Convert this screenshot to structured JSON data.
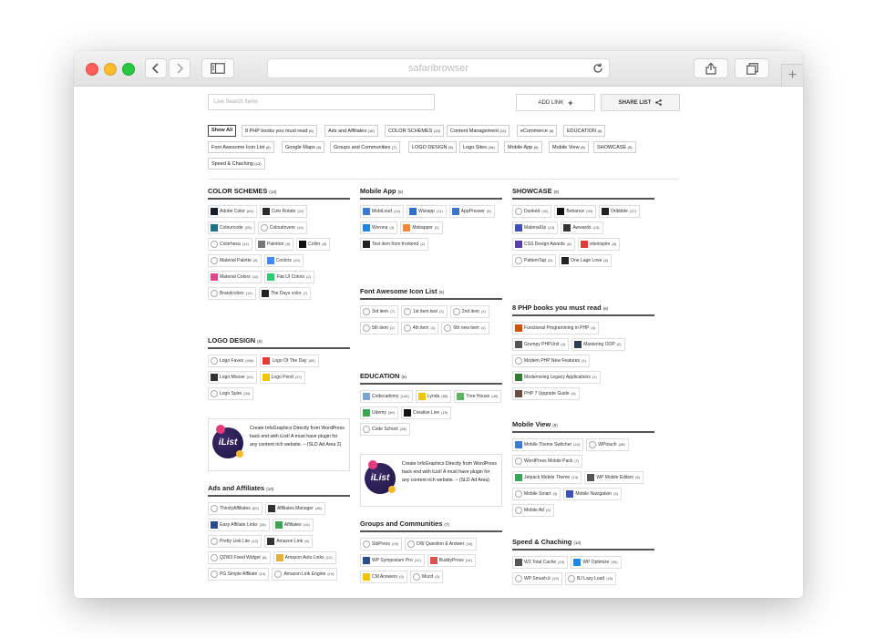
{
  "browser": {
    "address": "safaribrowser"
  },
  "toolbar": {
    "search_placeholder": "Live Search Items",
    "add_link_label": "ADD LINK",
    "add_icon": "+",
    "share_list_label": "SHARE LIST"
  },
  "filters": [
    {
      "label": "Show All",
      "count": ""
    },
    {
      "label": "8 PHP books you must read",
      "count": "(6)"
    },
    {
      "label": "Ads and Affiliates",
      "count": "(10)"
    },
    {
      "label": "COLOR SCHEMES",
      "count": "(13)"
    },
    {
      "label": "Content Management",
      "count": "(11)"
    },
    {
      "label": "eCommerce",
      "count": "(6)"
    },
    {
      "label": "EDUCATION",
      "count": "(6)"
    },
    {
      "label": "Font Awesome Icon List",
      "count": "(6)"
    },
    {
      "label": "Google Maps",
      "count": "(8)"
    },
    {
      "label": "Groups and Communities",
      "count": "(7)"
    },
    {
      "label": "LOGO DESIGN",
      "count": "(5)"
    },
    {
      "label": "Logo Sites",
      "count": "(16)"
    },
    {
      "label": "Mobile App",
      "count": "(6)"
    },
    {
      "label": "Mobile View",
      "count": "(8)"
    },
    {
      "label": "SHOWCASE",
      "count": "(9)"
    },
    {
      "label": "Speed & Chaching",
      "count": "(13)"
    }
  ],
  "ad": {
    "logo_text": "iList",
    "text": "Create InfoGraphics Directly from WordPress back end with iList! A must have plugin for any content rich website. – (SLD Ad Area 2)",
    "text2": "Create InfoGraphics Directly from WordPress back end with iList! A must have plugin for any content rich website. – (SLD Ad Area)"
  },
  "sections": {
    "color_schemes": {
      "title": "COLOR SCHEMES",
      "count": "(13)",
      "items": [
        {
          "label": "Adobe Color",
          "count": "(63)",
          "color": "#1b1b2f"
        },
        {
          "label": "Colo Rotate",
          "count": "(22)",
          "color": "#2a2a2a"
        },
        {
          "label": "Colourcode",
          "count": "(25)",
          "color": "#1f6f8b"
        },
        {
          "label": "Colourlovers",
          "count": "(14)",
          "color": "#ffffff"
        },
        {
          "label": "Colorhexa",
          "count": "(14)",
          "color": "#ffffff"
        },
        {
          "label": "Paletton",
          "count": "(6)",
          "color": "#777777"
        },
        {
          "label": "Collor",
          "count": "(6)",
          "color": "#111111"
        },
        {
          "label": "Material Palette",
          "count": "(9)",
          "color": "#ffffff"
        },
        {
          "label": "Coolors",
          "count": "(10)",
          "color": "#3d8af7"
        },
        {
          "label": "Material Colors",
          "count": "(11)",
          "color": "#e0468a"
        },
        {
          "label": "Flat UI Colors",
          "count": "(2)",
          "color": "#2ecc71"
        },
        {
          "label": "Brandcolors",
          "count": "(12)",
          "color": "#ffffff"
        },
        {
          "label": "The Days color",
          "count": "(7)",
          "color": "#222222"
        }
      ]
    },
    "logo_design": {
      "title": "LOGO DESIGN",
      "count": "(5)",
      "items": [
        {
          "label": "Logo Faves",
          "count": "(494)",
          "color": "#ffffff"
        },
        {
          "label": "Logo Of The Day",
          "count": "(82)",
          "color": "#e53935"
        },
        {
          "label": "Logo Moose",
          "count": "(41)",
          "color": "#333333"
        },
        {
          "label": "Logo Pond",
          "count": "(37)",
          "color": "#f5c400"
        },
        {
          "label": "Logo Spire",
          "count": "(34)",
          "color": "#ffffff"
        }
      ]
    },
    "ads_affiliates": {
      "title": "Ads and Affiliates",
      "count": "(10)",
      "items": [
        {
          "label": "ThirstyAffiliates",
          "count": "(62)",
          "color": "#ffffff"
        },
        {
          "label": "Affiliates Manager",
          "count": "(48)",
          "color": "#333333"
        },
        {
          "label": "Easy Affiliate Links",
          "count": "(26)",
          "color": "#2a4d8f"
        },
        {
          "label": "Affiliates",
          "count": "(14)",
          "color": "#3aa655"
        },
        {
          "label": "Pretty Link Lite",
          "count": "(12)",
          "color": "#ffffff"
        },
        {
          "label": "Amazon Link",
          "count": "(6)",
          "color": "#333333"
        },
        {
          "label": "Q2W3 Fixed Widget",
          "count": "(6)",
          "color": "#ffffff"
        },
        {
          "label": "Amazon Auto Links",
          "count": "(12)",
          "color": "#e4b23a"
        },
        {
          "label": "PG Simple Affiliate",
          "count": "(10)",
          "color": "#ffffff"
        },
        {
          "label": "Amazon Link Engine",
          "count": "(10)",
          "color": "#ffffff"
        }
      ]
    },
    "mobile_app": {
      "title": "Mobile App",
      "count": "(6)",
      "items": [
        {
          "label": "MobiLoud",
          "count": "(14)",
          "color": "#3a7bd5"
        },
        {
          "label": "Wiziapp",
          "count": "(11)",
          "color": "#2f6fcf"
        },
        {
          "label": "AppPresser",
          "count": "(5)",
          "color": "#3b76c4"
        },
        {
          "label": "Worona",
          "count": "(3)",
          "color": "#1e88e5"
        },
        {
          "label": "Mobapper",
          "count": "(2)",
          "color": "#f08a3a"
        },
        {
          "label": "Test item from frontend",
          "count": "(2)",
          "color": "#222222"
        }
      ]
    },
    "font_awesome": {
      "title": "Font Awesome Icon List",
      "count": "(6)",
      "items": [
        {
          "label": "3rd item",
          "count": "(7)",
          "color": "#ffffff"
        },
        {
          "label": "1st item test",
          "count": "(2)",
          "color": "#ffffff"
        },
        {
          "label": "2nd item",
          "count": "(1)",
          "color": "#ffffff"
        },
        {
          "label": "5th item",
          "count": "(1)",
          "color": "#ffffff"
        },
        {
          "label": "4th item",
          "count": "(1)",
          "color": "#ffffff"
        },
        {
          "label": "6th new item",
          "count": "(1)",
          "color": "#ffffff"
        }
      ]
    },
    "education": {
      "title": "EDUCATION",
      "count": "(6)",
      "items": [
        {
          "label": "Codecademy",
          "count": "(144)",
          "color": "#7aa4d8"
        },
        {
          "label": "Lynda",
          "count": "(85)",
          "color": "#f5c400"
        },
        {
          "label": "Tree House",
          "count": "(45)",
          "color": "#5cb85c"
        },
        {
          "label": "Udemy",
          "count": "(36)",
          "color": "#3aa655"
        },
        {
          "label": "Creative Live",
          "count": "(19)",
          "color": "#111111"
        },
        {
          "label": "Code School",
          "count": "(28)",
          "color": "#ffffff"
        }
      ]
    },
    "groups": {
      "title": "Groups and Communities",
      "count": "(7)",
      "items": [
        {
          "label": "SibPress",
          "count": "(20)",
          "color": "#ffffff"
        },
        {
          "label": "DW Question & Answer",
          "count": "(16)",
          "color": "#ffffff"
        },
        {
          "label": "WP Symposium Pro",
          "count": "(12)",
          "color": "#2a4d8f"
        },
        {
          "label": "BuddyPress",
          "count": "(14)",
          "color": "#d9534f"
        },
        {
          "label": "CM Answers",
          "count": "(9)",
          "color": "#f5c400"
        },
        {
          "label": "Mucd",
          "count": "(3)",
          "color": "#ffffff"
        }
      ]
    },
    "showcase": {
      "title": "SHOWCASE",
      "count": "(9)",
      "items": [
        {
          "label": "Dunked",
          "count": "(32)",
          "color": "#ffffff"
        },
        {
          "label": "Behance",
          "count": "(29)",
          "color": "#111111"
        },
        {
          "label": "Dribbble",
          "count": "(17)",
          "color": "#222222"
        },
        {
          "label": "MaterialUp",
          "count": "(13)",
          "color": "#3f51b5"
        },
        {
          "label": "Awwards",
          "count": "(13)",
          "color": "#333333"
        },
        {
          "label": "CSS Design Awards",
          "count": "(8)",
          "color": "#5b3fa8"
        },
        {
          "label": "siteinspire",
          "count": "(8)",
          "color": "#e53935"
        },
        {
          "label": "PatternTap",
          "count": "(5)",
          "color": "#ffffff"
        },
        {
          "label": "One Lage Love",
          "count": "(6)",
          "color": "#222222"
        }
      ]
    },
    "php_books": {
      "title": "8 PHP books you must read",
      "count": "(6)",
      "items": [
        {
          "label": "Functional Programming in PHP",
          "count": "(4)",
          "color": "#d35400"
        },
        {
          "label": "Grumpy PHPUnit",
          "count": "(4)",
          "color": "#555555"
        },
        {
          "label": "Mastering OOP",
          "count": "(2)",
          "color": "#2c3e50"
        },
        {
          "label": "Modern PHP New Features",
          "count": "(1)",
          "color": "#ffffff"
        },
        {
          "label": "Modernising Legacy Applications",
          "count": "(1)",
          "color": "#2e7d32"
        },
        {
          "label": "PHP 7 Upgrade Guide",
          "count": "(4)",
          "color": "#6d4c41"
        }
      ]
    },
    "mobile_view": {
      "title": "Mobile View",
      "count": "(8)",
      "items": [
        {
          "label": "Mobile Theme Switcher",
          "count": "(22)",
          "color": "#3a7bd5"
        },
        {
          "label": "WPtouch",
          "count": "(38)",
          "color": "#ffffff"
        },
        {
          "label": "WordPress Mobile Pack",
          "count": "(7)",
          "color": "#ffffff"
        },
        {
          "label": "Jetpack Mobile Theme",
          "count": "(13)",
          "color": "#3aa655"
        },
        {
          "label": "WP Mobile Edition",
          "count": "(6)",
          "color": "#555555"
        },
        {
          "label": "Mobile Smart",
          "count": "(3)",
          "color": "#ffffff"
        },
        {
          "label": "Mobile Navigation",
          "count": "(3)",
          "color": "#3f51b5"
        },
        {
          "label": "Mobile Ad",
          "count": "(3)",
          "color": "#ffffff"
        }
      ]
    },
    "speed": {
      "title": "Speed & Chaching",
      "count": "(13)",
      "items": [
        {
          "label": "W3 Total Cache",
          "count": "(23)",
          "color": "#555555"
        },
        {
          "label": "WP Optimize",
          "count": "(30)",
          "color": "#1e88e5"
        },
        {
          "label": "WP Smush.it",
          "count": "(19)",
          "color": "#ffffff"
        },
        {
          "label": "BJ Lazy Load",
          "count": "(15)",
          "color": "#ffffff"
        }
      ]
    }
  }
}
